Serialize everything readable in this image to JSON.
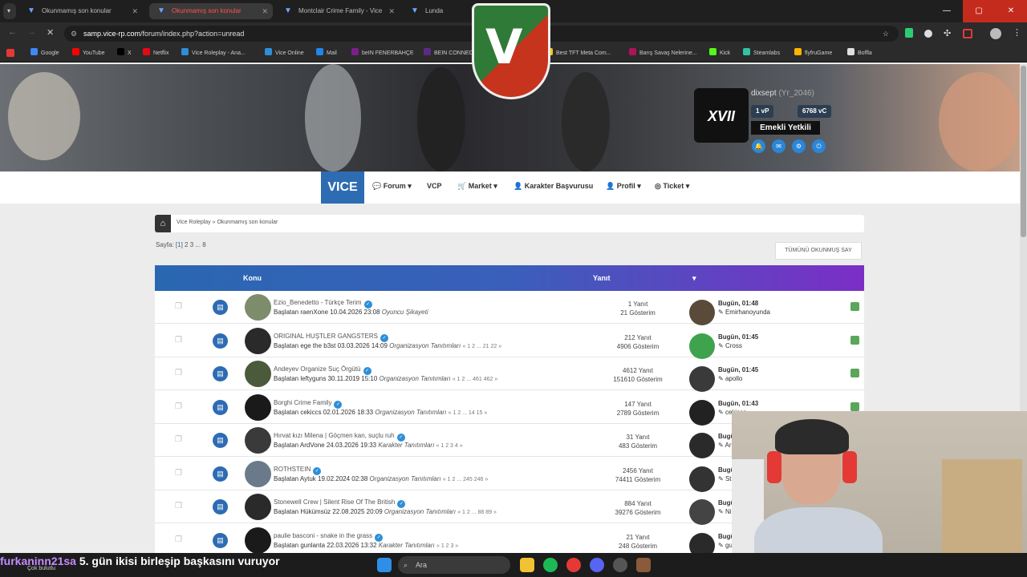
{
  "browser": {
    "tabs": [
      {
        "label": "Okunmamış son konular",
        "active": false
      },
      {
        "label": "Okunmamış son konular",
        "active": true
      },
      {
        "label": "Montclair Crime Family - Vice",
        "active": false
      },
      {
        "label": "Lunda",
        "active": false
      }
    ],
    "url_host": "samp.vice-rp.com",
    "url_path": "/forum/index.php?action=unread",
    "bookmarks": [
      {
        "label": "Google",
        "color": "#4285f4"
      },
      {
        "label": "YouTube",
        "color": "#ff0000"
      },
      {
        "label": "X",
        "color": "#000000"
      },
      {
        "label": "Netflix",
        "color": "#e50914"
      },
      {
        "label": "Vice Roleplay - Ana...",
        "color": "#2d8fd8"
      },
      {
        "label": "Vice Online",
        "color": "#2d8fd8"
      },
      {
        "label": "Mail",
        "color": "#1e88e5"
      },
      {
        "label": "beIN FENERBAHÇE",
        "color": "#7a1f8a"
      },
      {
        "label": "BEIN CONNECT",
        "color": "#5b2a86"
      },
      {
        "label": "Kamu Bülteni",
        "color": "#c62828"
      },
      {
        "label": "Best TFT Meta Com...",
        "color": "#f5c518"
      },
      {
        "label": "Barış Savaş Nelerine...",
        "color": "#ad1457"
      },
      {
        "label": "Kick",
        "color": "#53fc18"
      },
      {
        "label": "Steamlabs",
        "color": "#31c3a2"
      },
      {
        "label": "flyfruGame",
        "color": "#ffb300"
      },
      {
        "label": "Boffla",
        "color": "#e0e0e0"
      }
    ]
  },
  "banner": {
    "username": "dixsept",
    "username_suffix": "(Yr_2046)",
    "vp": "1 vP",
    "vc": "6768 vC",
    "role": "Emekli Yetkili",
    "logo_mark": "V",
    "tag_mark": "XVII"
  },
  "nav": {
    "logo": "VICE",
    "items": [
      "Forum",
      "VCP",
      "Market",
      "Karakter Başvurusu",
      "Profil",
      "Ticket"
    ]
  },
  "breadcrumb": {
    "root": "Vice Roleplay »",
    "current": "Okunmamış son konular"
  },
  "pager": {
    "label": "Sayfa:",
    "current": "1",
    "pages": "2 3 ... 8"
  },
  "mark_all_read": "TÜMÜNÜ OKUNMUŞ SAY",
  "table": {
    "col_topic": "Konu",
    "col_replies": "Yanıt",
    "rows": [
      {
        "title": "Ezio_Benedetto - Türkçe Terim",
        "started_by": "Başlatan raenXone 10.04.2026 23:08",
        "board": "Oyuncu Şikayeti",
        "pages": "",
        "replies": "1 Yanıt",
        "views": "21 Gösterim",
        "last_time": "Bugün, 01:48",
        "last_user": "Emirhanoyunda",
        "avatar_color": "#7d8c6a",
        "last_color": "#5a4a3a"
      },
      {
        "title": "ORIGINAL HUŞTLER GANGSTERS",
        "started_by": "Başlatan ege the b3st 03.03.2026 14:09",
        "board": "Organizasyon Tanıtımları",
        "pages": "« 1 2 ... 21 22 »",
        "replies": "212 Yanıt",
        "views": "4906 Gösterim",
        "last_time": "Bugün, 01:45",
        "last_user": "Cross",
        "avatar_color": "#2a2a2a",
        "last_color": "#3fa34d"
      },
      {
        "title": "Andeyev Organize Suç Örgütü",
        "started_by": "Başlatan leftyguns 30.11.2019 15:10",
        "board": "Organizasyon Tanıtımları",
        "pages": "« 1 2 ... 461 462 »",
        "replies": "4612 Yanıt",
        "views": "151610 Gösterim",
        "last_time": "Bugün, 01:45",
        "last_user": "apollo",
        "avatar_color": "#4a5a3a",
        "last_color": "#3a3a3a"
      },
      {
        "title": "Borghi Crime Family",
        "started_by": "Başlatan cekiccs 02.01.2026 18:33",
        "board": "Organizasyon Tanıtımları",
        "pages": "« 1 2 ... 14 15 »",
        "replies": "147 Yanıt",
        "views": "2789 Gösterim",
        "last_time": "Bugün, 01:43",
        "last_user": "cekiccs",
        "avatar_color": "#1a1a1a",
        "last_color": "#222222"
      },
      {
        "title": "Hırvat kızı Milena | Göçmen kan, suçlu ruh",
        "started_by": "Başlatan ArdVone 24.03.2026 19:33",
        "board": "Karakter Tanıtımları",
        "pages": "« 1 2 3 4 »",
        "replies": "31 Yanıt",
        "views": "483 Gösterim",
        "last_time": "Bugün",
        "last_user": "Ar",
        "avatar_color": "#3a3a3a",
        "last_color": "#2a2a2a"
      },
      {
        "title": "ROTHSTEIN",
        "started_by": "Başlatan Aytuk 19.02.2024 02:38",
        "board": "Organizasyon Tanıtımları",
        "pages": "« 1 2 ... 245 246 »",
        "replies": "2456 Yanıt",
        "views": "74411 Gösterim",
        "last_time": "Bugün",
        "last_user": "St",
        "avatar_color": "#6a7a8a",
        "last_color": "#333333"
      },
      {
        "title": "Stonewell Crew | Silent Rise Of The British",
        "started_by": "Başlatan Hükümsüz 22.08.2025 20:09",
        "board": "Organizasyon Tanıtımları",
        "pages": "« 1 2 ... 88 89 »",
        "replies": "884 Yanıt",
        "views": "39276 Gösterim",
        "last_time": "Bugün",
        "last_user": "Ni",
        "avatar_color": "#2a2a2a",
        "last_color": "#444444"
      },
      {
        "title": "paulie basconi - snake in the grass",
        "started_by": "Başlatan gunlanta 22.03.2026 13:32",
        "board": "Karakter Tanıtımları",
        "pages": "« 1 2 3 »",
        "replies": "21 Yanıt",
        "views": "248 Gösterim",
        "last_time": "Bugün",
        "last_user": "gu",
        "avatar_color": "#1a1a1a",
        "last_color": "#2a2a2a"
      }
    ]
  },
  "stream_overlay": {
    "nick": "furkaninn21sa",
    "message": "5. gün ikisi birleşip başkasını vuruyor",
    "weather": "Çok bulutlu"
  },
  "taskbar": {
    "search_placeholder": "Ara"
  }
}
